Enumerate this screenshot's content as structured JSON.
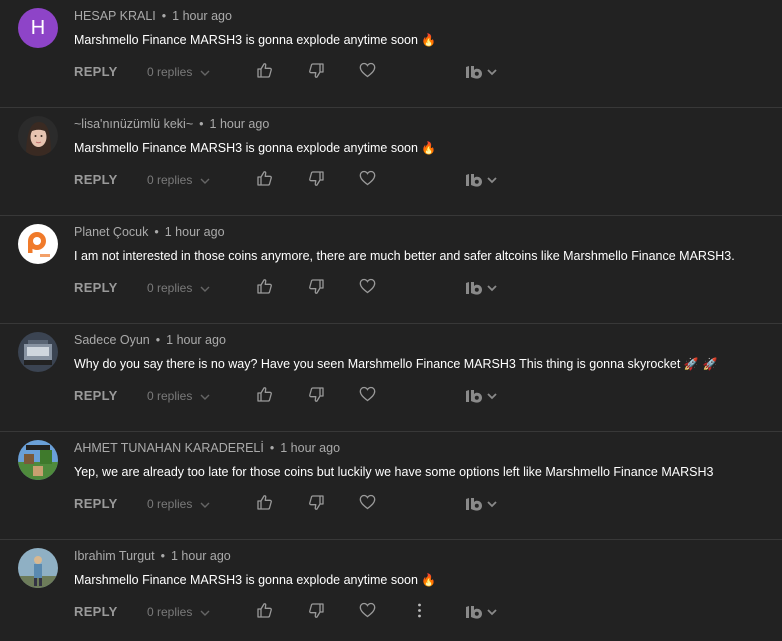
{
  "comments": [
    {
      "author": "HESAP KRALI",
      "time": "1 hour ago",
      "text": "Marshmello Finance MARSH3 is gonna explode anytime soon",
      "emoji": "🔥",
      "avatar": {
        "type": "letter",
        "letter": "H",
        "color": "#8e44c8"
      },
      "reply_label": "REPLY",
      "replies_label": "0 replies"
    },
    {
      "author": "~lisa'nınüzümlü keki~",
      "time": "1 hour ago",
      "text": "Marshmello Finance MARSH3 is gonna explode anytime soon",
      "emoji": "🔥",
      "avatar": {
        "type": "photo",
        "color": "#c9a08a"
      },
      "reply_label": "REPLY",
      "replies_label": "0 replies"
    },
    {
      "author": "Planet Çocuk",
      "time": "1 hour ago",
      "text": "I am not interested in those coins anymore, there are much better and safer altcoins like Marshmello Finance MARSH3.",
      "emoji": "",
      "avatar": {
        "type": "logo",
        "color": "#f07a2a"
      },
      "reply_label": "REPLY",
      "replies_label": "0 replies"
    },
    {
      "author": "Sadece Oyun",
      "time": "1 hour ago",
      "text": "Why do you say there is no way? Have you seen Marshmello Finance MARSH3 This thing is gonna skyrocket",
      "emoji": "🚀 🚀",
      "avatar": {
        "type": "photo",
        "color": "#556070"
      },
      "reply_label": "REPLY",
      "replies_label": "0 replies"
    },
    {
      "author": "AHMET TUNAHAN KARADERELİ",
      "time": "1 hour ago",
      "text": "Yep, we are already too late for those coins but luckily we have some options left like Marshmello Finance MARSH3",
      "emoji": "",
      "avatar": {
        "type": "photo",
        "color": "#4f8a3c"
      },
      "reply_label": "REPLY",
      "replies_label": "0 replies"
    },
    {
      "author": "Ibrahim Turgut",
      "time": "1 hour ago",
      "text": "Marshmello Finance MARSH3 is gonna explode anytime soon",
      "emoji": "🔥",
      "avatar": {
        "type": "photo",
        "color": "#6f8fa6"
      },
      "reply_label": "REPLY",
      "replies_label": "0 replies",
      "show_more_menu": true
    }
  ]
}
